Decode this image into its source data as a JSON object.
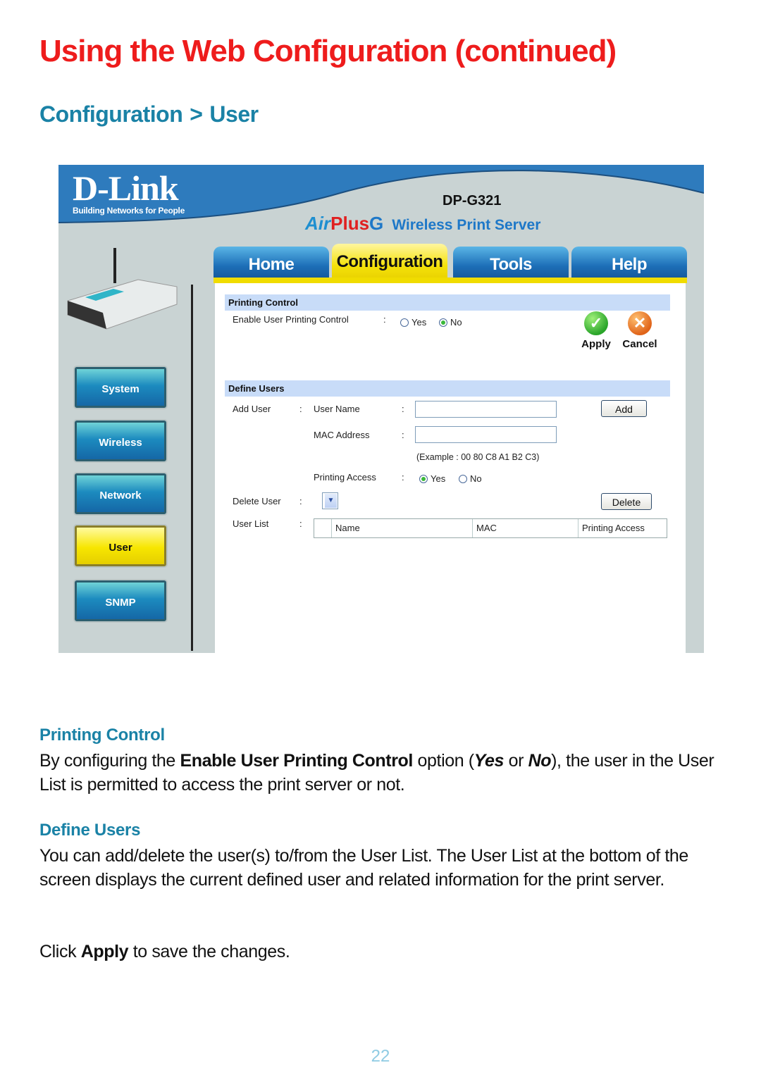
{
  "title": "Using the Web Configuration (continued)",
  "breadcrumb": {
    "parent": "Configuration",
    "separator": ">",
    "current": "User"
  },
  "screenshot": {
    "brand": "D-Link",
    "brand_tagline": "Building Networks for People",
    "model": "DP-G321",
    "product_line": {
      "air": "Air",
      "plus": "Plus",
      "g": "G",
      "subtitle": "Wireless Print Server"
    },
    "tabs": [
      {
        "label": "Home",
        "active": false
      },
      {
        "label": "Configuration",
        "active": true
      },
      {
        "label": "Tools",
        "active": false
      },
      {
        "label": "Help",
        "active": false
      }
    ],
    "sidebar": [
      {
        "label": "System",
        "active": false
      },
      {
        "label": "Wireless",
        "active": false
      },
      {
        "label": "Network",
        "active": false
      },
      {
        "label": "User",
        "active": true
      },
      {
        "label": "SNMP",
        "active": false
      }
    ],
    "printing_control": {
      "header": "Printing Control",
      "field_label": "Enable User Printing Control",
      "colon": ":",
      "options": [
        "Yes",
        "No"
      ],
      "selected": "No",
      "apply_label": "Apply",
      "cancel_label": "Cancel"
    },
    "define_users": {
      "header": "Define Users",
      "add_user_label": "Add User",
      "user_name_label": "User Name",
      "user_name_value": "",
      "mac_label": "MAC Address",
      "mac_value": "",
      "mac_example": "(Example : 00 80 C8 A1 B2 C3)",
      "printing_access_label": "Printing Access",
      "printing_access_options": [
        "Yes",
        "No"
      ],
      "printing_access_selected": "Yes",
      "add_button": "Add",
      "delete_user_label": "Delete User",
      "delete_button": "Delete",
      "user_list_label": "User List",
      "user_list_columns": [
        "",
        "Name",
        "MAC",
        "Printing Access"
      ],
      "colon": ":"
    }
  },
  "body": {
    "printing_control_heading": "Printing Control",
    "printing_control_text": {
      "pre": "By configuring the ",
      "bold": "Enable User Printing Control",
      "mid": " option (",
      "yes": "Yes",
      "or": " or ",
      "no": "No",
      "post": "), the user in the User List is permitted to access the print server or not."
    },
    "define_users_heading": "Define Users",
    "define_users_text": "You can add/delete the user(s) to/from the User List. The User List at the bottom of the screen displays the current defined user and related information for the print server.",
    "apply_text": {
      "pre": "Click ",
      "bold": "Apply",
      "post": " to save the changes."
    }
  },
  "page_number": "22",
  "colors": {
    "title": "#ee1c1c",
    "heading": "#1a82a6",
    "page_number": "#8fcbe3"
  }
}
